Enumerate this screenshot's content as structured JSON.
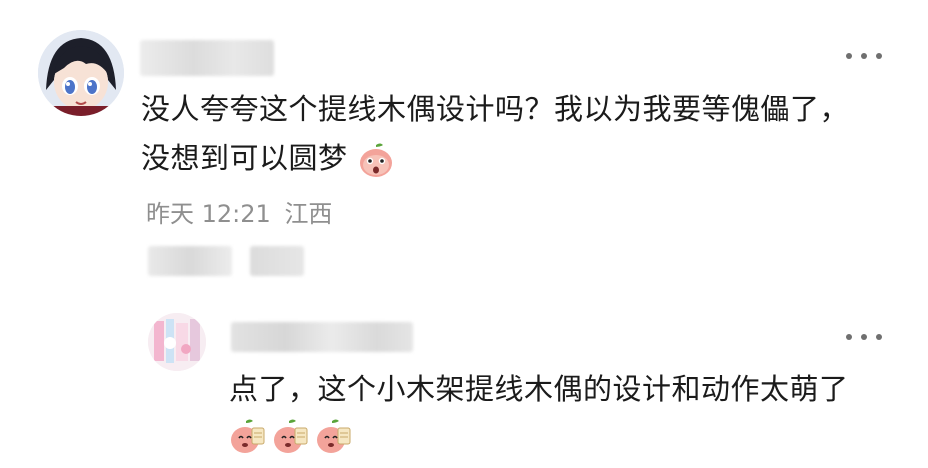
{
  "comment": {
    "line1": "没人夸夸这个提线木偶设计吗？我以为我要等傀儡了，",
    "line2": "没想到可以圆梦",
    "time": "昨天 12:21",
    "location": "江西"
  },
  "reply": {
    "text": "点了，这个小木架提线木偶的设计和动作太萌了"
  },
  "icons": {
    "more": "more-dots-icon",
    "emoji_main": "peach-shocked-emoji-icon",
    "emoji_reply": "peach-sticker-emoji-icon"
  }
}
